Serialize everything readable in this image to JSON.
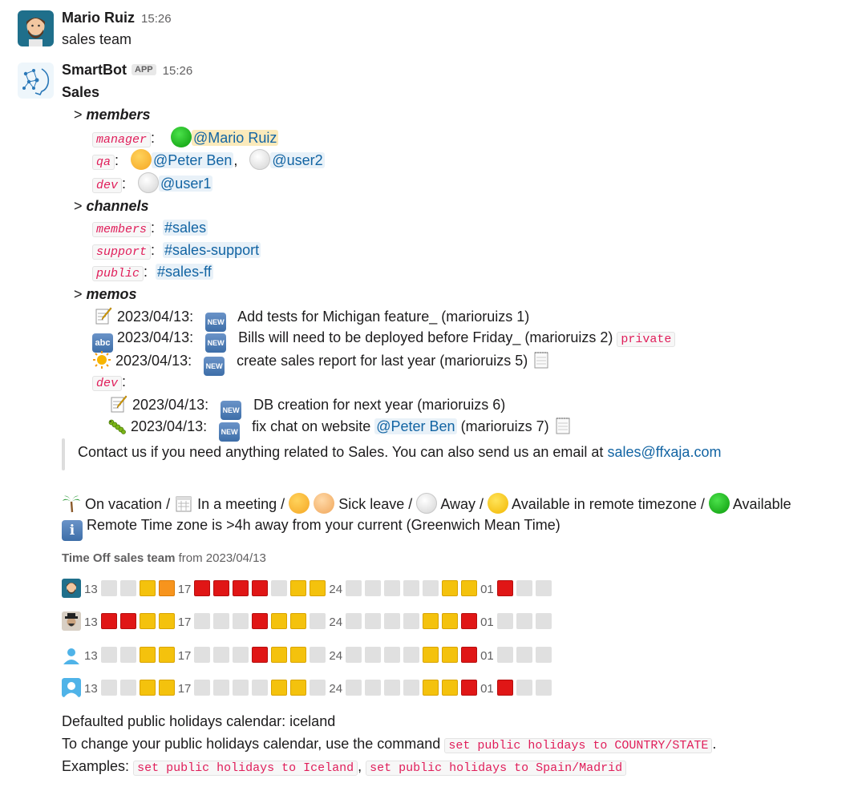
{
  "message1": {
    "user": "Mario Ruiz",
    "time": "15:26",
    "text": "sales team"
  },
  "message2": {
    "user": "SmartBot",
    "badge": "APP",
    "time": "15:26",
    "title": "Sales",
    "members_heading": "members",
    "members": {
      "manager_key": "manager",
      "manager_value": "@Mario Ruiz",
      "qa_key": "qa",
      "qa_values": [
        "@Peter Ben",
        "@user2"
      ],
      "dev_key": "dev",
      "dev_value": "@user1"
    },
    "channels_heading": "channels",
    "channels": [
      {
        "key": "members",
        "value": "#sales"
      },
      {
        "key": "support",
        "value": "#sales-support"
      },
      {
        "key": "public",
        "value": "#sales-ff"
      }
    ],
    "memos_heading": "memos",
    "memos": [
      {
        "icon": "memo-icon",
        "date": "2023/04/13:",
        "badge": "NEW",
        "text": "Add tests for Michigan feature_ (marioruizs 1)",
        "tag": ""
      },
      {
        "icon": "abc-icon",
        "date": "2023/04/13:",
        "badge": "NEW",
        "text": "Bills will need to be deployed before Friday_ (marioruizs 2)",
        "tag": "private"
      },
      {
        "icon": "sun-icon",
        "date": "2023/04/13:",
        "badge": "NEW",
        "text": "create sales report for last year (marioruizs 5)",
        "tag": ""
      }
    ],
    "dev_memos_key": "dev",
    "dev_memos": [
      {
        "icon": "memo-icon",
        "date": "2023/04/13:",
        "badge": "NEW",
        "text": "DB creation for next year (marioruizs 6)"
      },
      {
        "icon": "bug-icon",
        "date": "2023/04/13:",
        "badge": "NEW",
        "text_before": "fix chat on website",
        "mention": "@Peter Ben",
        "text_after": "(marioruizs 7)"
      }
    ],
    "contact_text": "Contact us if you need anything related to Sales. You can also send us an email at",
    "contact_email": "sales@ffxaja.com",
    "legend": {
      "vacation": "On vacation /",
      "meeting": "In a meeting /",
      "sick": "Sick leave /",
      "away": "Away /",
      "remote": "Available in remote timezone /",
      "available": "Available"
    },
    "remote_note": "Remote Time zone is >4h away from your current (Greenwich Mean Time)",
    "timeoff": {
      "title_bold": "Time Off sales team",
      "title_rest": "from 2023/04/13",
      "labels": [
        "13",
        "17",
        "24",
        "01"
      ],
      "rows": [
        {
          "avatar": "bearded-man-avatar",
          "days": [
            "g",
            "g",
            "y",
            "o",
            "r",
            "r",
            "r",
            "r",
            "g",
            "y",
            "y",
            "g",
            "g",
            "g",
            "g",
            "g",
            "y",
            "y",
            "r",
            "g",
            "g"
          ]
        },
        {
          "avatar": "hat-man-avatar",
          "days": [
            "r",
            "r",
            "y",
            "y",
            "g",
            "g",
            "g",
            "r",
            "y",
            "y",
            "g",
            "g",
            "g",
            "g",
            "g",
            "y",
            "y",
            "r",
            "g",
            "g",
            "g"
          ]
        },
        {
          "avatar": "default-user-avatar",
          "days": [
            "g",
            "g",
            "y",
            "y",
            "g",
            "g",
            "g",
            "r",
            "y",
            "y",
            "g",
            "g",
            "g",
            "g",
            "g",
            "y",
            "y",
            "r",
            "g",
            "g",
            "g"
          ]
        },
        {
          "avatar": "default-user-avatar-2",
          "days": [
            "g",
            "g",
            "y",
            "y",
            "g",
            "g",
            "g",
            "g",
            "y",
            "y",
            "g",
            "g",
            "g",
            "g",
            "g",
            "y",
            "y",
            "r",
            "r",
            "g",
            "g"
          ]
        }
      ]
    },
    "holidays_default": "Defaulted public holidays calendar: iceland",
    "holidays_change_text": "To change your public holidays calendar, use the command",
    "holidays_change_cmd": "set public holidays to COUNTRY/STATE",
    "examples_label": "Examples:",
    "examples": [
      "set public holidays to Iceland",
      "set public holidays to Spain/Madrid"
    ]
  }
}
